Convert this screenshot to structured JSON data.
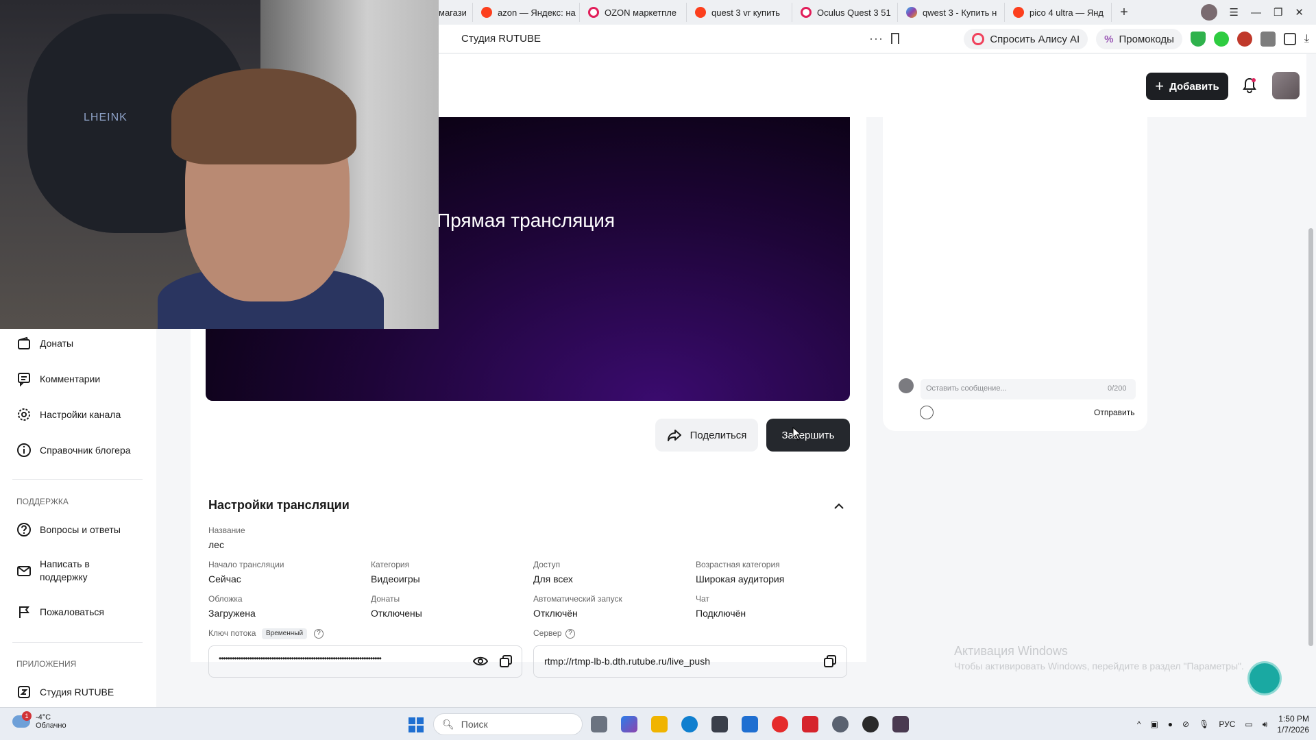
{
  "browser": {
    "tabs": [
      {
        "label": "магази",
        "favicon": "yandex-icon"
      },
      {
        "label": "azon — Яндекс: на",
        "favicon": "yandex-icon"
      },
      {
        "label": "OZON маркетпле",
        "favicon": "ozon-icon"
      },
      {
        "label": "quest 3 vr купить",
        "favicon": "yandex-icon"
      },
      {
        "label": "Oculus Quest 3 51",
        "favicon": "ozon-icon"
      },
      {
        "label": "qwest 3 - Купить н",
        "favicon": "marketplace-icon"
      },
      {
        "label": "pico 4 ultra — Янд",
        "favicon": "yandex-icon"
      }
    ],
    "page_title": "Студия RUTUBE",
    "ask_alisa": "Спросить Алису AI",
    "promo": "Промокоды"
  },
  "header": {
    "add_label": "Добавить"
  },
  "sidebar": {
    "items": [
      {
        "label": "Донаты",
        "icon": "wallet-icon"
      },
      {
        "label": "Комментарии",
        "icon": "comment-icon"
      },
      {
        "label": "Настройки канала",
        "icon": "gear-icon"
      },
      {
        "label": "Справочник блогера",
        "icon": "info-icon"
      }
    ],
    "support_title": "ПОДДЕРЖКА",
    "support_items": [
      {
        "label": "Вопросы и ответы",
        "icon": "question-icon"
      },
      {
        "label": "Написать в поддержку",
        "icon": "mail-icon"
      },
      {
        "label": "Пожаловаться",
        "icon": "flag-icon"
      }
    ],
    "apps_title": "ПРИЛОЖЕНИЯ",
    "apps_items": [
      {
        "label": "Студия RUTUBE",
        "icon": "studio-icon"
      }
    ]
  },
  "player": {
    "title": "Прямая трансляция",
    "share_label": "Поделиться",
    "finish_label": "Завершить"
  },
  "chat": {
    "placeholder": "Оставить сообщение...",
    "counter": "0/200",
    "send_label": "Отправить"
  },
  "settings": {
    "title": "Настройки трансляции",
    "name_label": "Название",
    "name_value": "лес",
    "fields": [
      {
        "label": "Начало трансляции",
        "value": "Сейчас"
      },
      {
        "label": "Категория",
        "value": "Видеоигры"
      },
      {
        "label": "Доступ",
        "value": "Для всех"
      },
      {
        "label": "Возрастная категория",
        "value": "Широкая аудитория"
      },
      {
        "label": "Обложка",
        "value": "Загружена"
      },
      {
        "label": "Донаты",
        "value": "Отключены"
      },
      {
        "label": "Автоматический запуск",
        "value": "Отключён"
      },
      {
        "label": "Чат",
        "value": "Подключён"
      }
    ],
    "stream_key_label": "Ключ потока",
    "stream_key_badge": "Временный",
    "stream_key_value": "••••••••••••••••••••••••••••••••••••••••••••••••••••••••••••••••••••••••••",
    "server_label": "Сервер",
    "server_value": "rtmp://rtmp-lb-b.dth.rutube.ru/live_push"
  },
  "watermark": {
    "line1": "Активация Windows",
    "line2": "Чтобы активировать Windows, перейдите в раздел \"Параметры\"."
  },
  "taskbar": {
    "weather_temp": "-4°C",
    "weather_desc": "Облачно",
    "weather_badge": "1",
    "search_placeholder": "Поиск",
    "lang": "РУС",
    "time": "1:50 PM",
    "date": "1/7/2026"
  },
  "webcam": {
    "logo_text": "LHEINK"
  }
}
